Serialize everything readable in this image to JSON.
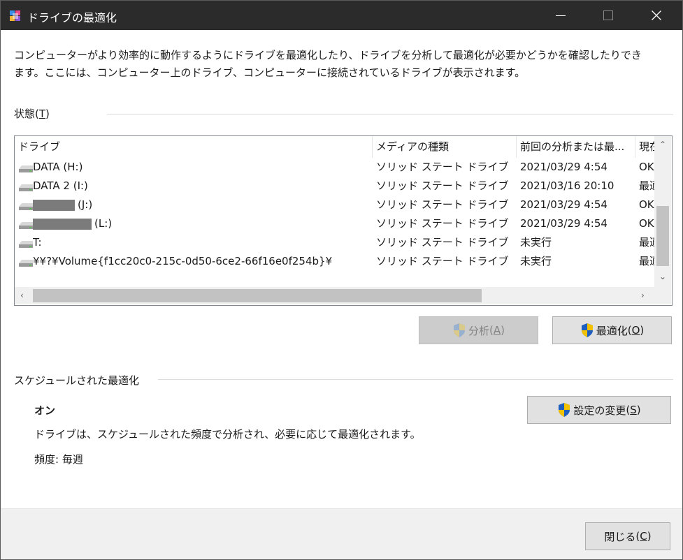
{
  "window": {
    "title": "ドライブの最適化"
  },
  "description": "コンピューターがより効率的に動作するようにドライブを最適化したり、ドライブを分析して最適化が必要かどうかを確認したりできます。ここには、コンピューター上のドライブ、コンピューターに接続されているドライブが表示されます。",
  "status": {
    "label": "状態",
    "accel": "T",
    "columns": [
      "ドライブ",
      "メディアの種類",
      "前回の分析または最...",
      "現在"
    ],
    "drives": [
      {
        "name": "DATA (H:)",
        "redacted": false,
        "media": "ソリッド ステート ドライブ",
        "last": "2021/03/29 4:54",
        "status": "OK"
      },
      {
        "name": "DATA 2 (I:)",
        "redacted": false,
        "media": "ソリッド ステート ドライブ",
        "last": "2021/03/16 20:10",
        "status": "最適化が必要です"
      },
      {
        "name": "(J:)",
        "redacted": true,
        "media": "ソリッド ステート ドライブ",
        "last": "2021/03/29 4:54",
        "status": "OK"
      },
      {
        "name": "(L:)",
        "redacted": true,
        "media": "ソリッド ステート ドライブ",
        "last": "2021/03/29 4:54",
        "status": "OK"
      },
      {
        "name": "T:",
        "redacted": false,
        "media": "ソリッド ステート ドライブ",
        "last": "未実行",
        "status": "最適化が必要です"
      },
      {
        "name": "¥¥?¥Volume{f1cc20c0-215c-0d50-6ce2-66f16e0f254b}¥",
        "redacted": false,
        "media": "ソリッド ステート ドライブ",
        "last": "未実行",
        "status": "最適化が必要です"
      }
    ]
  },
  "actions": {
    "analyze": {
      "label": "分析",
      "accel": "A",
      "enabled": false
    },
    "optimize": {
      "label": "最適化",
      "accel": "O",
      "enabled": true
    }
  },
  "schedule": {
    "label": "スケジュールされた最適化",
    "state": "オン",
    "description": "ドライブは、スケジュールされた頻度で分析され、必要に応じて最適化されます。",
    "frequency": "頻度: 毎週",
    "change_button": {
      "label": "設定の変更",
      "accel": "S"
    }
  },
  "footer": {
    "close_button": {
      "label": "閉じる",
      "accel": "C"
    }
  },
  "icons": {
    "app": "defrag-app-icon",
    "drive": "drive-icon",
    "shield": "uac-shield-icon"
  },
  "colors": {
    "titlebar": "#2b2b2b",
    "button": "#e1e1e1",
    "button_disabled": "#cccccc",
    "footer": "#f0f0f0",
    "shield_blue": "#1f5fbf",
    "shield_yellow": "#f2c200"
  }
}
